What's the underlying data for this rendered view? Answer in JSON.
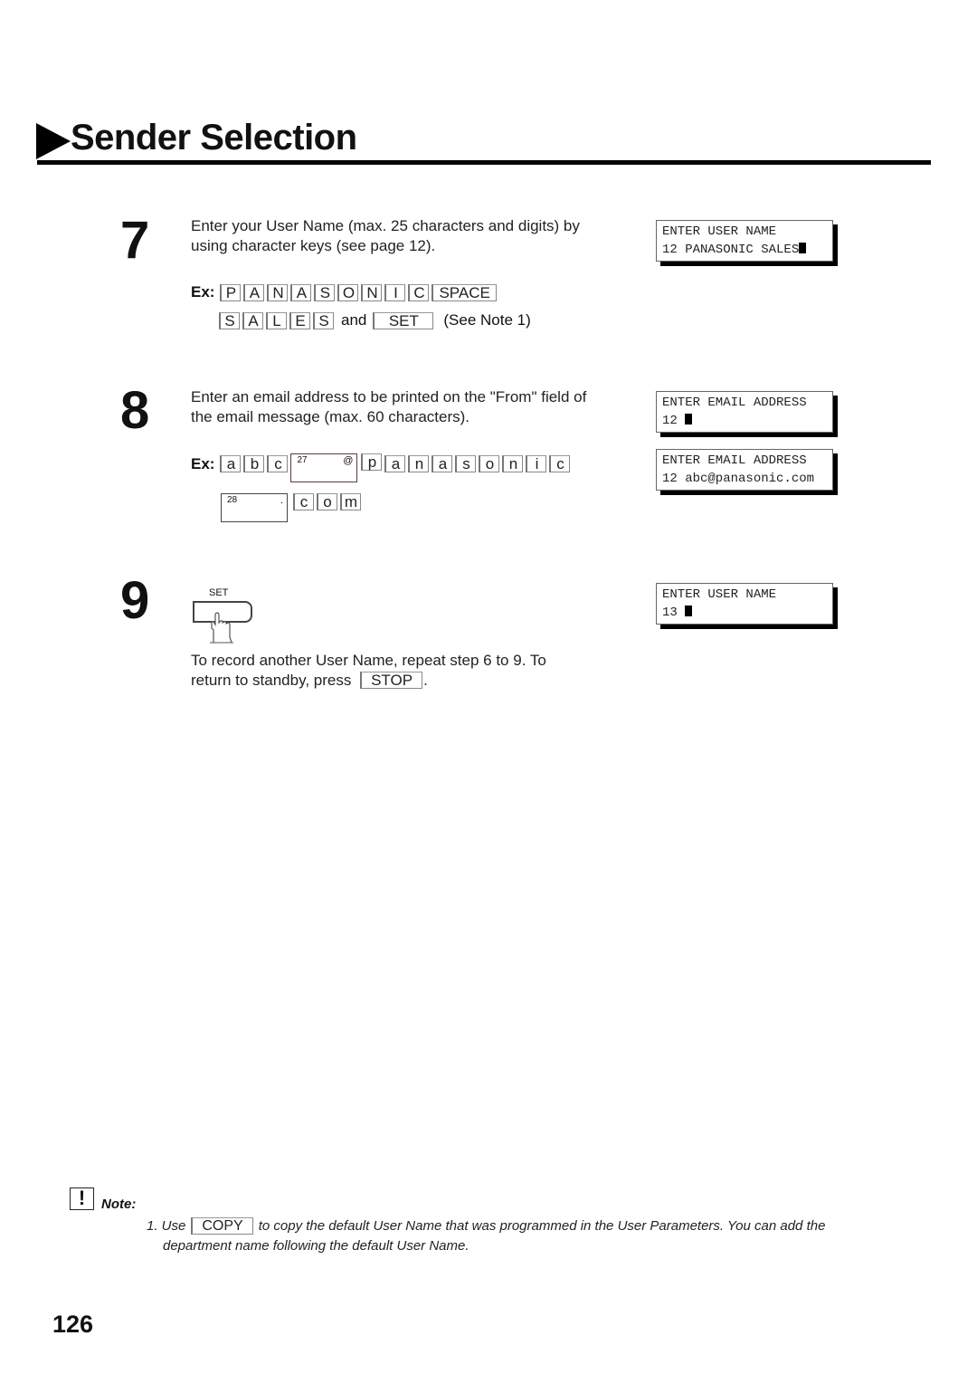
{
  "header": {
    "title": "Sender Selection",
    "arrow_icon": "right-triangle-icon"
  },
  "steps": [
    {
      "number": "7",
      "text_line1": "Enter your User Name (max. 25 characters and digits) by",
      "text_line2": "using character keys (see page 12).",
      "ex_label": "Ex:",
      "row1_keys": [
        "P",
        "A",
        "N",
        "A",
        "S",
        "O",
        "N",
        "I",
        "C",
        "SPACE"
      ],
      "row2_keys": [
        "S",
        "A",
        "L",
        "E",
        "S"
      ],
      "and_text": "and",
      "set_key": "SET",
      "see_note": "(See Note 1)",
      "display": {
        "line1": "ENTER USER NAME",
        "line2": "12 PANASONIC SALES"
      }
    },
    {
      "number": "8",
      "text_line1": "Enter an email address to be printed on the \"From\" field of",
      "text_line2": "the email message (max. 60 characters).",
      "ex_label": "Ex:",
      "row1_keys_a": [
        "a",
        "b",
        "c"
      ],
      "at_key": {
        "number": "27",
        "symbol": "@"
      },
      "row1_keys_b": [
        "p",
        "a",
        "n",
        "a",
        "s",
        "o",
        "n",
        "i",
        "c"
      ],
      "dot_key": {
        "number": "28",
        "symbol": "."
      },
      "row2_keys": [
        "c",
        "o",
        "m"
      ],
      "display_1": {
        "line1": "ENTER EMAIL ADDRESS",
        "line2": "12 "
      },
      "display_2": {
        "line1": "ENTER EMAIL ADDRESS",
        "line2": "12 abc@panasonic.com"
      }
    },
    {
      "number": "9",
      "button_label": "SET",
      "text_line1": "To record another User Name, repeat step 6 to 9.  To",
      "text_line2_pre": "return to standby, press",
      "stop_key": "STOP",
      "text_line2_post": ".",
      "display": {
        "line1": "ENTER USER NAME",
        "line2": "13 "
      }
    }
  ],
  "note": {
    "icon": "exclamation-icon",
    "label": "Note:",
    "item_prefix": "1.  Use",
    "copy_key": "COPY",
    "item_text": "to copy the default User Name that was programmed in the User Parameters.  You can add the",
    "item_line2": "department name following the default User Name."
  },
  "page_number": "126"
}
